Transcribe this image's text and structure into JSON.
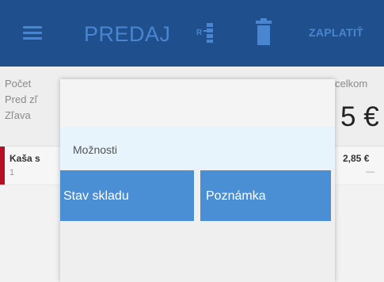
{
  "appbar": {
    "title": "PREDAJ",
    "pay_label": "ZAPLATIŤ",
    "icons": [
      "menu-icon",
      "register-icon",
      "trash-icon"
    ]
  },
  "summary": {
    "lines": [
      "Počet",
      "Pred zľ",
      "Zľava"
    ],
    "total_label": "Spolu celkom",
    "total_visible_label": "celkom",
    "total_value_visible": "5 €"
  },
  "item": {
    "name_visible": "Kaša s",
    "quantity": "1",
    "price": "2,85 €",
    "dash": "—"
  },
  "dialog": {
    "subtitle": "Možnosti",
    "options": [
      {
        "label": "Stav skladu"
      },
      {
        "label": "Poznámka"
      }
    ]
  },
  "colors": {
    "appbar_bg": "#1f4f8c",
    "appbar_fg": "#4a86cf",
    "option_button": "#4a8ed4",
    "item_marker": "#b40f24",
    "subtitle_bar": "#e8f4fb"
  }
}
